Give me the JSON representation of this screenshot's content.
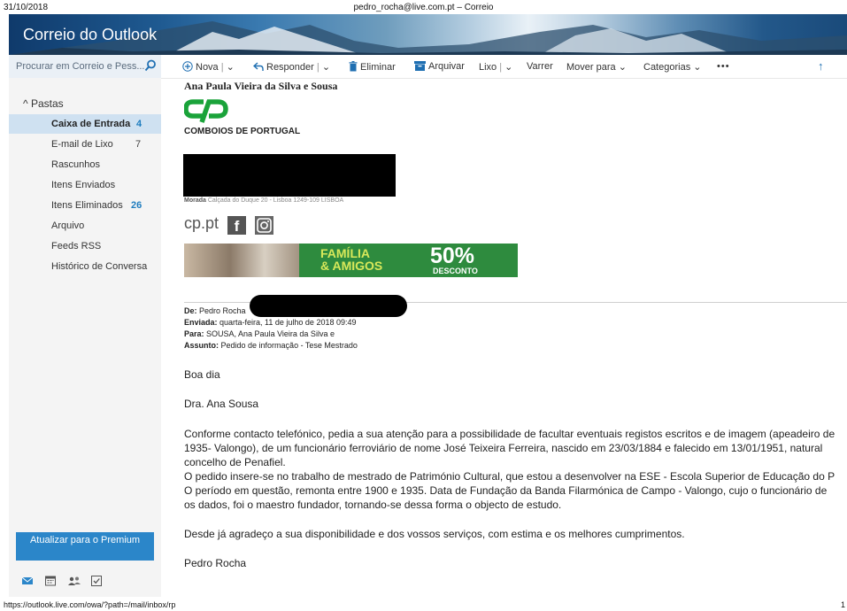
{
  "print": {
    "date": "31/10/2018",
    "title": "pedro_rocha@live.com.pt – Correio",
    "url": "https://outlook.live.com/owa/?path=/mail/inbox/rp",
    "page": "1"
  },
  "app": {
    "brand": "Correio do Outlook"
  },
  "search": {
    "placeholder": "Procurar em Correio e Pess..."
  },
  "toolbar": {
    "new": "Nova",
    "reply": "Responder",
    "delete": "Eliminar",
    "archive": "Arquivar",
    "junk": "Lixo",
    "sweep": "Varrer",
    "move": "Mover para",
    "categories": "Categorias",
    "more": "•••",
    "up": "↑"
  },
  "sidebar": {
    "header": "Pastas",
    "folders": [
      {
        "name": "Caixa de Entrada",
        "count": "4"
      },
      {
        "name": "E-mail de Lixo",
        "count": "7"
      },
      {
        "name": "Rascunhos",
        "count": ""
      },
      {
        "name": "Itens Enviados",
        "count": ""
      },
      {
        "name": "Itens Eliminados",
        "count": "26"
      },
      {
        "name": "Arquivo",
        "count": ""
      },
      {
        "name": "Feeds RSS",
        "count": ""
      },
      {
        "name": "Histórico de Conversa",
        "count": ""
      }
    ],
    "premium": "Atualizar para o Premium"
  },
  "message": {
    "sender_name": "Ana Paula Vieira da Silva e Sousa",
    "company": "COMBOIOS DE PORTUGAL",
    "address_label": "Morada",
    "address": "Calçada do Duque 20 - Lisboa 1249-109 LISBOA",
    "site": "cp.pt",
    "promo": {
      "line1": "FAMÍLIA",
      "line2": "& AMIGOS",
      "percent": "50%",
      "label": "DESCONTO"
    },
    "from_label": "De:",
    "from": "Pedro Rocha",
    "sent_label": "Enviada:",
    "sent": "quarta-feira, 11 de julho de 2018 09:49",
    "to_label": "Para:",
    "to": "SOUSA, Ana Paula Vieira da Silva e",
    "subject_label": "Assunto:",
    "subject": "Pedido de informação - Tese Mestrado",
    "greeting": "Boa dia",
    "salutation": "Dra. Ana Sousa",
    "p1_l1": "Conforme contacto telefónico, pedia a sua atenção para a possibilidade de facultar eventuais registos escritos e de imagem (apeadeiro de",
    "p1_l2": "1935- Valongo), de um funcionário ferroviário de nome José Teixeira Ferreira, nascido em 23/03/1884 e falecido em 13/01/1951, natural",
    "p1_l3": "concelho de Penafiel.",
    "p1_l4": "O pedido insere-se no trabalho de mestrado de Património Cultural, que estou a desenvolver na ESE - Escola Superior de Educação do P",
    "p1_l5": "O período em questão, remonta entre 1900 e 1935. Data de Fundação da Banda Filarmónica de Campo - Valongo, cujo o funcionário de",
    "p1_l6": "os dados, foi o maestro fundador, tornando-se dessa forma o objecto de estudo.",
    "p2": "Desde já agradeço a sua disponibilidade e dos vossos serviços, com estima e os melhores cumprimentos.",
    "signature": "Pedro Rocha"
  }
}
